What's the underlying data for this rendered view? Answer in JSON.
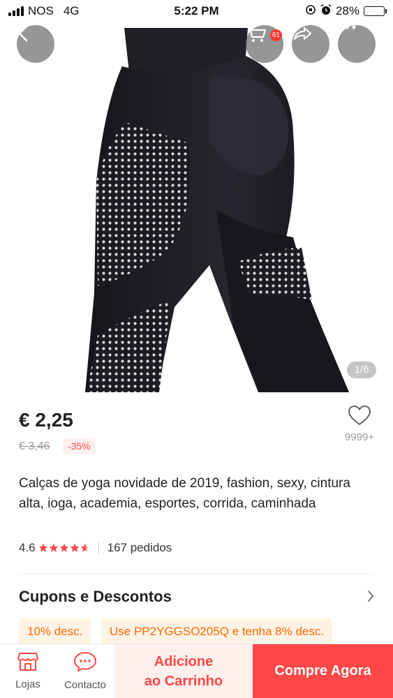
{
  "status_bar": {
    "carrier": "NOS",
    "network": "4G",
    "time": "5:22 PM",
    "battery": "28%",
    "battery_level": 0.28
  },
  "hero": {
    "cart_count": "61",
    "image_counter": "1/6",
    "icons": [
      "back-arrow-icon",
      "cart-icon",
      "share-icon",
      "more-icon"
    ]
  },
  "product": {
    "price": "€ 2,25",
    "old_price": "€ 3,46",
    "discount": "-35%",
    "wishlist_count": "9999+",
    "title": "Calças de yoga novidade de 2019, fashion, sexy, cintura alta, ioga, academia, esportes, corrida, caminhada",
    "rating": "4.6",
    "rating_value": 4.6,
    "orders": "167 pedidos"
  },
  "coupons": {
    "title": "Cupons e Descontos",
    "items": [
      "10% desc.",
      "Use PP2YGGSO205Q e tenha 8% desc."
    ]
  },
  "bottom_bar": {
    "store_label": "Lojas",
    "contact_label": "Contacto",
    "add_to_cart": "Adicione\nao Carrinho",
    "buy_now": "Compre Agora"
  },
  "colors": {
    "accent": "#ff4747",
    "coupon_text": "#ff6a00",
    "coupon_bg": "#fff3e6",
    "star": "#ff4747"
  }
}
